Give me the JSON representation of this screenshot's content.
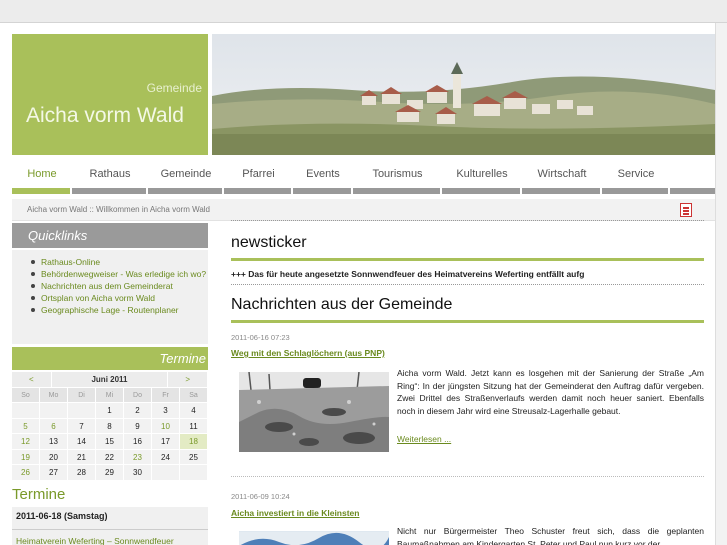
{
  "header": {
    "gemeinde": "Gemeinde",
    "name": "Aicha vorm Wald"
  },
  "nav": [
    {
      "label": "Home",
      "active": true
    },
    {
      "label": "Rathaus"
    },
    {
      "label": "Gemeinde"
    },
    {
      "label": "Pfarrei"
    },
    {
      "label": "Events"
    },
    {
      "label": "Tourismus"
    },
    {
      "label": "Kulturelles"
    },
    {
      "label": "Wirtschaft"
    },
    {
      "label": "Service"
    }
  ],
  "breadcrumb": "Aicha vorm Wald :: Willkommen in Aicha vorm Wald",
  "quicklinks": {
    "title": "Quicklinks",
    "items": [
      "Rathaus-Online",
      "Behördenwegweiser - Was erledige ich wo?",
      "Nachrichten aus dem Gemeinderat",
      "Ortsplan von Aicha vorm Wald",
      "Geographische Lage - Routenplaner"
    ]
  },
  "calendar": {
    "title": "Termine",
    "prev": "<",
    "next": ">",
    "month": "Juni 2011",
    "dow": [
      "So",
      "Mo",
      "Di",
      "Mi",
      "Do",
      "Fr",
      "Sa"
    ],
    "weeks": [
      [
        "",
        "",
        "",
        "1",
        "2",
        "3",
        "4"
      ],
      [
        "5",
        "6",
        "7",
        "8",
        "9",
        "10",
        "11"
      ],
      [
        "12",
        "13",
        "14",
        "15",
        "16",
        "17",
        "18"
      ],
      [
        "19",
        "20",
        "21",
        "22",
        "23",
        "24",
        "25"
      ],
      [
        "26",
        "27",
        "28",
        "29",
        "30",
        "",
        ""
      ]
    ],
    "today": "18"
  },
  "termine": {
    "title": "Termine",
    "date": "2011-06-18 (Samstag)",
    "link": "Heimatverein Weferting – Sonnwendfeuer"
  },
  "newsticker": {
    "title": "newsticker",
    "text": "+++ Das für heute angesetzte Sonnwendfeuer des Heimatvereins Weferting entfällt aufg"
  },
  "news": {
    "title": "Nachrichten aus der Gemeinde",
    "articles": [
      {
        "date": "2011-06-16 07:23",
        "title": "Weg mit den Schlaglöchern (aus PNP)",
        "text": "Aicha vorm Wald. Jetzt kann es losgehen mit der Sanierung der Straße „Am Ring“: In der jüngsten Sitzung hat der Gemeinderat den Auftrag dafür vergeben. Zwei Drittel des Straßenverlaufs werden damit noch heuer saniert. Ebenfalls noch in diesem Jahr wird eine Streusalz-Lagerhalle gebaut.",
        "more": "Weiterlesen ..."
      },
      {
        "date": "2011-06-09 10:24",
        "title": "Aicha investiert in die Kleinsten",
        "text": "Nicht nur Bürgermeister Theo Schuster freut sich, dass die geplanten Baumaßnahmen am Kindergarten St. Peter und Paul nun kurz vor der"
      }
    ]
  },
  "colors": {
    "accent": "#a9c05a",
    "link": "#6a8a1e",
    "nav_inactive": "#999999"
  }
}
